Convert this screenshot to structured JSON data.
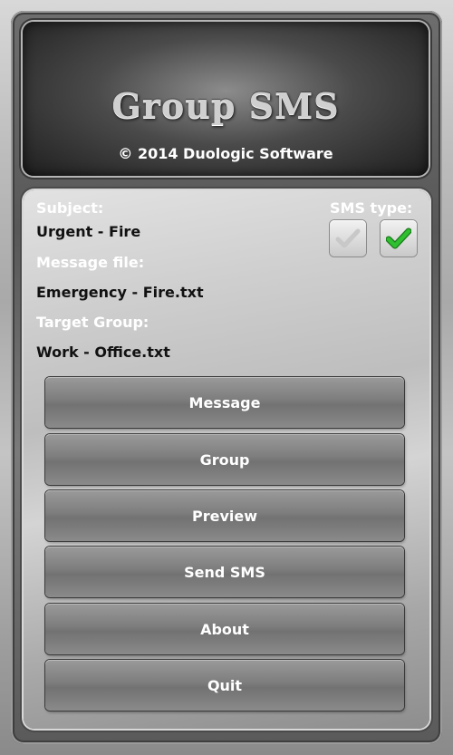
{
  "header": {
    "title": "Group SMS",
    "copyright": "© 2014 Duologic Software"
  },
  "form": {
    "subject_label": "Subject:",
    "subject_value": "Urgent - Fire",
    "message_file_label": "Message file:",
    "message_file_value": "Emergency - Fire.txt",
    "target_group_label": "Target Group:",
    "target_group_value": "Work - Office.txt"
  },
  "sms_type": {
    "label": "SMS type:",
    "options": [
      {
        "icon": "check-icon",
        "checked": false,
        "color": "#c8c8c8"
      },
      {
        "icon": "check-icon",
        "checked": true,
        "color": "#2fbf2f"
      }
    ]
  },
  "buttons": {
    "message": "Message",
    "group": "Group",
    "preview": "Preview",
    "send_sms": "Send SMS",
    "about": "About",
    "quit": "Quit"
  }
}
